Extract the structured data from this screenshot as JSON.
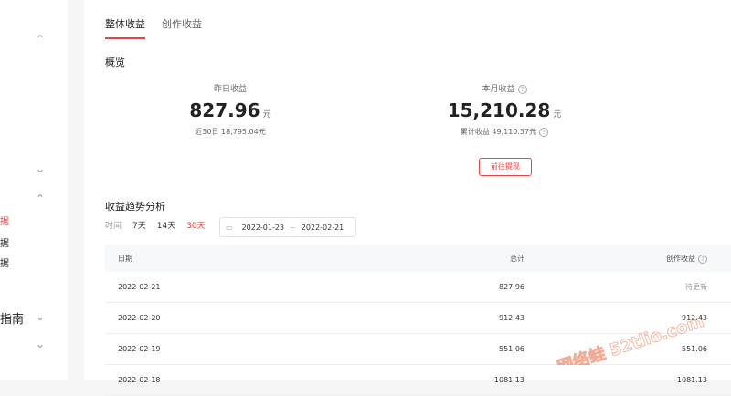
{
  "sidebar": {
    "items": [
      {
        "label": "据"
      },
      {
        "label": "据"
      },
      {
        "label": "据"
      }
    ],
    "guide_label": "指南"
  },
  "tabs": [
    {
      "label": "整体收益",
      "active": true
    },
    {
      "label": "创作收益",
      "active": false
    }
  ],
  "overview": {
    "title": "概览",
    "yesterday": {
      "label": "昨日收益",
      "value": "827.96",
      "unit": "元",
      "sub": "近30日 18,795.04元"
    },
    "month": {
      "label": "本月收益",
      "value": "15,210.28",
      "unit": "元",
      "sub": "累计收益 49,110.37元"
    },
    "withdraw_label": "前往提现"
  },
  "trend": {
    "title": "收益趋势分析",
    "time_label": "时间",
    "options": [
      "7天",
      "14天",
      "30天"
    ],
    "active_option": "30天",
    "date_start": "2022-01-23",
    "date_sep": "~",
    "date_end": "2022-02-21"
  },
  "table": {
    "headers": [
      "日期",
      "总计",
      "创作收益"
    ],
    "rows": [
      {
        "date": "2022-02-21",
        "total": "827.96",
        "creative": "待更新"
      },
      {
        "date": "2022-02-20",
        "total": "912.43",
        "creative": "912.43"
      },
      {
        "date": "2022-02-19",
        "total": "551.06",
        "creative": "551.06"
      },
      {
        "date": "2022-02-18",
        "total": "1081.13",
        "creative": "1081.13"
      }
    ]
  },
  "watermark": "网络蛙 52tlio.com",
  "colors": {
    "accent": "#f04142"
  }
}
